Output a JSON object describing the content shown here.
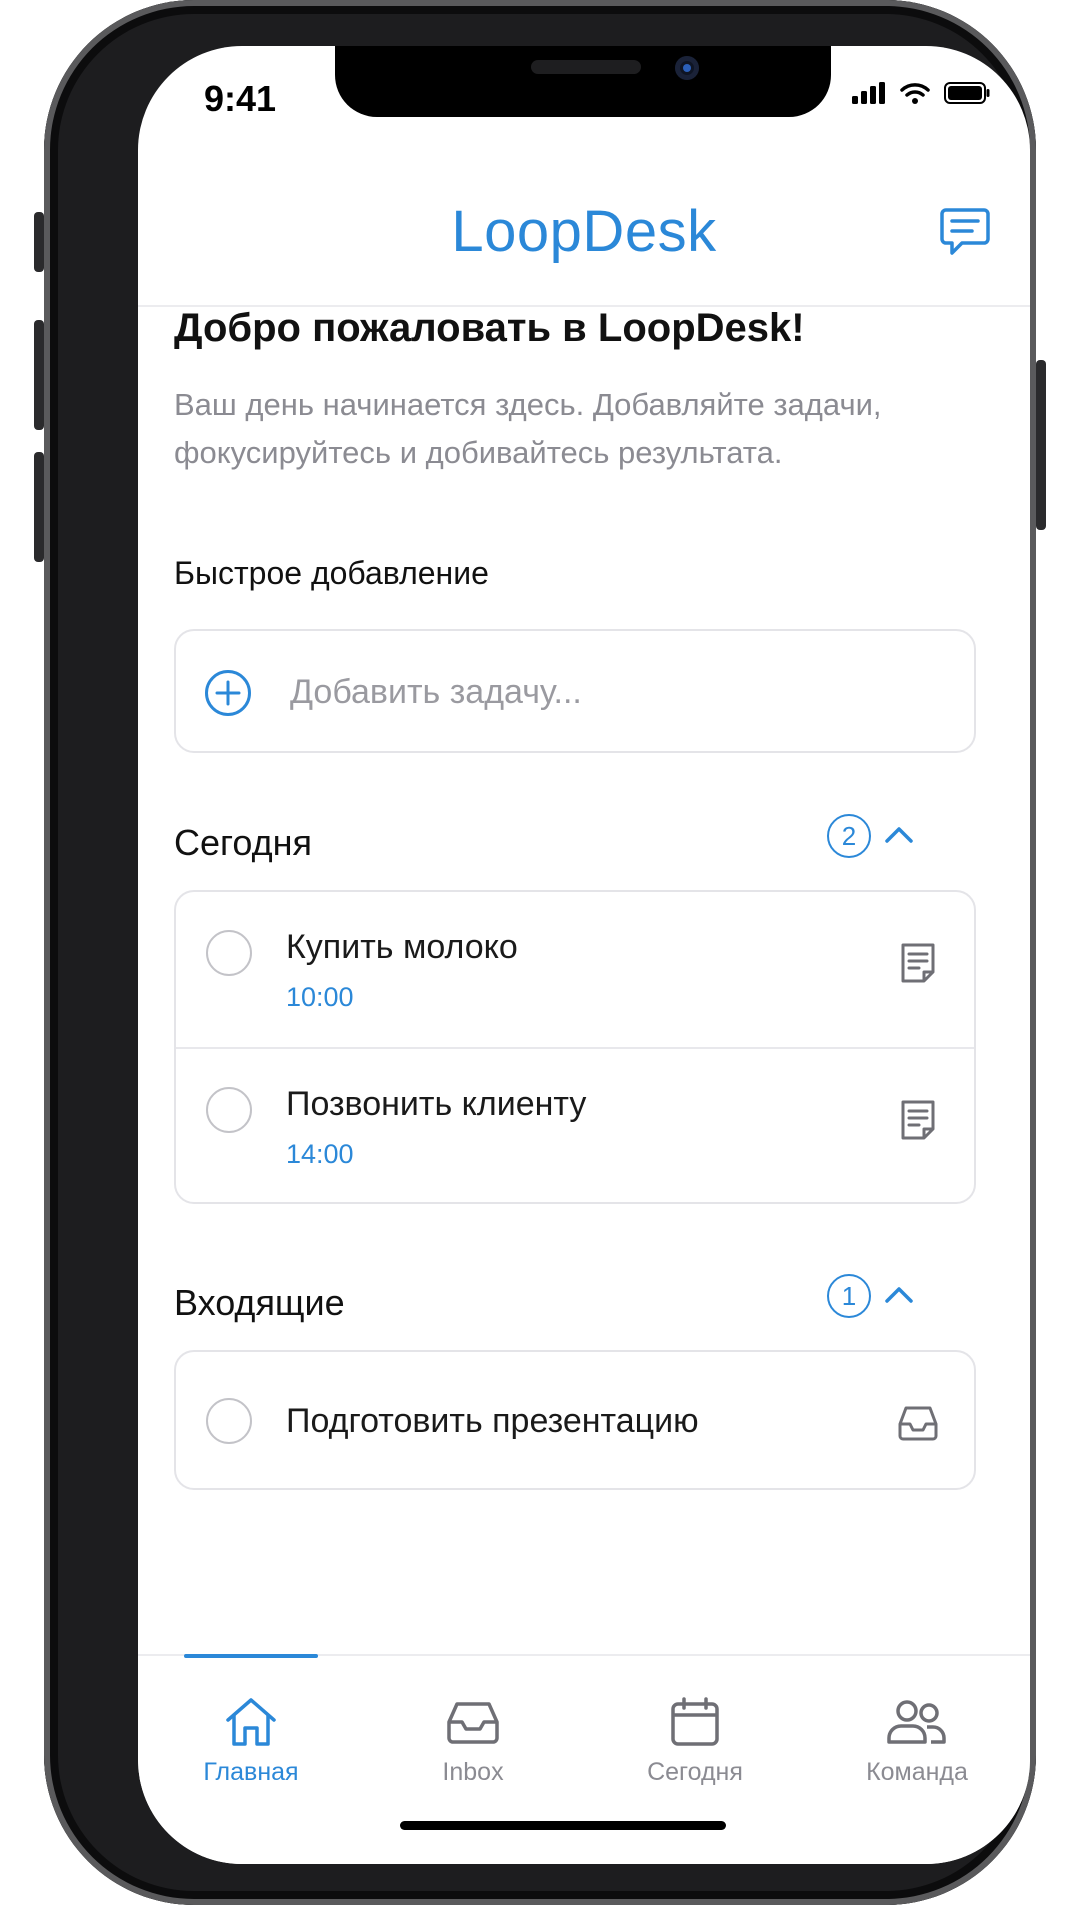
{
  "status_bar": {
    "time": "9:41"
  },
  "header": {
    "app_title": "LoopDesk",
    "chat_icon": "chat-message-icon"
  },
  "welcome": {
    "title": "Добро пожаловать в LoopDesk!",
    "subtitle": "Ваш день начинается здесь. Добавляйте задачи, фокусируйтесь и добивайтесь результата."
  },
  "quick_add": {
    "label": "Быстрое добавление",
    "placeholder": "Добавить задачу..."
  },
  "sections": {
    "today": {
      "title": "Сегодня",
      "count": "2",
      "tasks": [
        {
          "title": "Купить молоко",
          "time": "10:00",
          "icon": "note-icon"
        },
        {
          "title": "Позвонить клиенту",
          "time": "14:00",
          "icon": "note-icon"
        }
      ]
    },
    "inbox": {
      "title": "Входящие",
      "count": "1",
      "tasks": [
        {
          "title": "Подготовить презентацию",
          "icon": "inbox-tray-icon"
        }
      ]
    }
  },
  "tabbar": {
    "active": "home",
    "tabs": [
      {
        "label": "Главная",
        "icon": "home-icon"
      },
      {
        "label": "Inbox",
        "icon": "inbox-tray-icon"
      },
      {
        "label": "Сегодня",
        "icon": "calendar-icon"
      },
      {
        "label": "Команда",
        "icon": "team-icon"
      }
    ]
  },
  "colors": {
    "accent": "#2b88d8",
    "text_primary": "#111111",
    "text_secondary": "#8b8b92",
    "border": "#e4e4e8"
  }
}
